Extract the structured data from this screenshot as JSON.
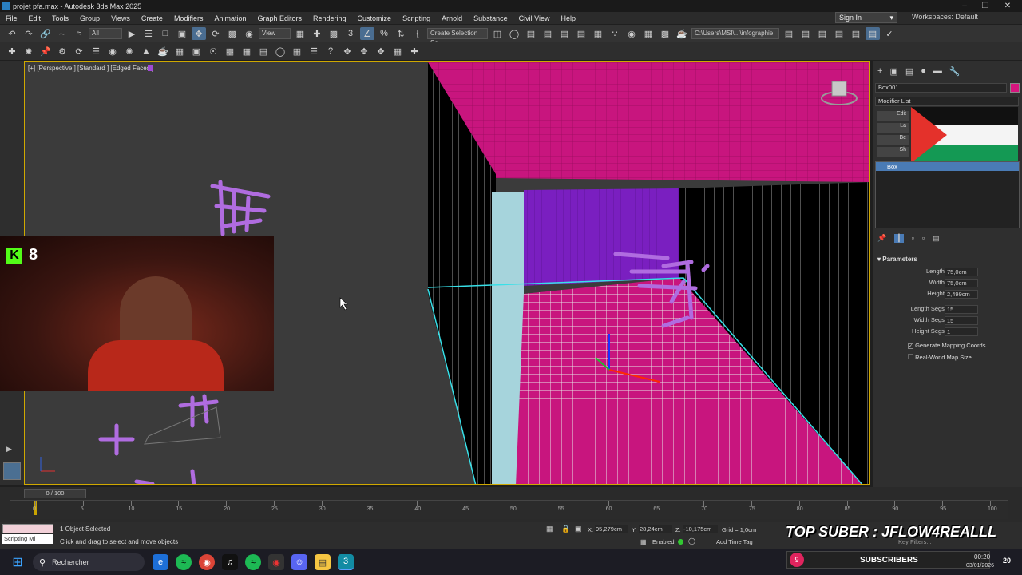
{
  "title": "projet pfa.max - Autodesk 3ds Max 2025",
  "menu": [
    "File",
    "Edit",
    "Tools",
    "Group",
    "Views",
    "Create",
    "Modifiers",
    "Animation",
    "Graph Editors",
    "Rendering",
    "Customize",
    "Scripting",
    "Arnold",
    "Substance",
    "Civil View",
    "Help"
  ],
  "sign_in": "Sign In",
  "workspaces_label": "Workspaces:",
  "workspaces_value": "Default",
  "toolbar": {
    "selection_filter": "All",
    "ref_coord": "View",
    "selection_set": "Create Selection Se",
    "project_path": "C:\\Users\\MSI\\...\\infographie"
  },
  "viewport": {
    "label": "[+] [Perspective ] [Standard ] [Edged Faces ]"
  },
  "webcam": {
    "badge_letter": "K",
    "badge_count": "8"
  },
  "command_panel": {
    "object_name": "Box001",
    "modifier_list": "Modifier List",
    "buttons": [
      "Edit",
      "La",
      "Be",
      "Sh"
    ],
    "stack_item": "Box",
    "parameters_title": "Parameters",
    "params": [
      {
        "label": "Length:",
        "value": "75,0cm"
      },
      {
        "label": "Width:",
        "value": "75,0cm"
      },
      {
        "label": "Height:",
        "value": "2,499cm"
      },
      {
        "label": "Length Segs:",
        "value": "15"
      },
      {
        "label": "Width Segs:",
        "value": "15"
      },
      {
        "label": "Height Segs:",
        "value": "1"
      }
    ],
    "generate_mapping": "Generate Mapping Coords.",
    "real_world": "Real-World Map Size"
  },
  "timeline": {
    "frame": "0 / 100",
    "ticks": [
      "0",
      "5",
      "10",
      "15",
      "20",
      "25",
      "30",
      "35",
      "40",
      "45",
      "50",
      "55",
      "60",
      "65",
      "70",
      "75",
      "80",
      "85",
      "90",
      "95",
      "100"
    ]
  },
  "status": {
    "script_label": "Scripting Mi",
    "selected": "1 Object Selected",
    "prompt": "Click and drag to select and move objects",
    "x_label": "X:",
    "x": "95,279cm",
    "y_label": "Y:",
    "y": "28,24cm",
    "z_label": "Z:",
    "z": "-10,175cm",
    "grid": "Grid = 1,0cm",
    "enabled": "Enabled:",
    "add_time_tag": "Add Time Tag",
    "key_filters": "Key Filters..."
  },
  "overlay": {
    "top_suber": "TOP SUBER : JFLOW4REALLL",
    "subscribers_count": "9",
    "subscribers_label": "SUBSCRIBERS"
  },
  "taskbar": {
    "search": "Rechercher",
    "time": "00:20",
    "date": "03/01/2026",
    "notifications": "20"
  }
}
